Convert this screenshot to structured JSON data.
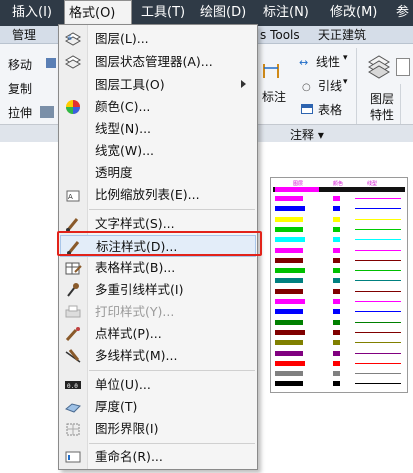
{
  "menubar": {
    "items": [
      "插入(I)",
      "格式(O)",
      "工具(T)",
      "绘图(D)",
      "标注(N)",
      "修改(M)",
      "参"
    ]
  },
  "tabs": [
    "管理",
    "s Tools",
    "天正建筑"
  ],
  "ribbon": {
    "left_tools": [
      "移动",
      "复制",
      "拉伸"
    ],
    "annotation_tools": [
      "标注",
      "线性",
      "引线",
      "表格"
    ],
    "layer_label": "图层",
    "layer_label2": "特性",
    "panel_title": "注释 ▾"
  },
  "format_menu": {
    "items": [
      {
        "label": "图层(L)...",
        "icon": "layer-icon"
      },
      {
        "label": "图层状态管理器(A)...",
        "icon": "layer-state-icon"
      },
      {
        "label": "图层工具(O)",
        "icon": "",
        "submenu": true
      },
      {
        "label": "颜色(C)...",
        "icon": "color-wheel-icon"
      },
      {
        "label": "线型(N)...",
        "icon": ""
      },
      {
        "label": "线宽(W)...",
        "icon": ""
      },
      {
        "label": "透明度",
        "icon": ""
      },
      {
        "label": "比例缩放列表(E)...",
        "icon": "scale-list-icon"
      },
      {
        "label": "文字样式(S)...",
        "icon": "text-style-icon"
      },
      {
        "label": "标注样式(D)...",
        "icon": "dim-style-icon"
      },
      {
        "label": "表格样式(B)...",
        "icon": "table-style-icon"
      },
      {
        "label": "多重引线样式(I)",
        "icon": "mleader-style-icon"
      },
      {
        "label": "打印样式(Y)...",
        "icon": "plot-style-icon",
        "disabled": true
      },
      {
        "label": "点样式(P)...",
        "icon": "point-style-icon"
      },
      {
        "label": "多线样式(M)...",
        "icon": "mline-style-icon"
      },
      {
        "label": "单位(U)...",
        "icon": "units-icon"
      },
      {
        "label": "厚度(T)",
        "icon": "thickness-icon"
      },
      {
        "label": "图形界限(I)",
        "icon": "limits-icon"
      },
      {
        "label": "重命名(R)...",
        "icon": "rename-icon"
      }
    ],
    "highlighted": "标注样式(D)..."
  },
  "sheet": {
    "headers": [
      "图层",
      "颜色",
      "线型"
    ],
    "colors": [
      "#ff00ff",
      "#0000ff",
      "#ffff00",
      "#00cc00",
      "#00ffff",
      "#ff00ff",
      "#800000",
      "#00c000",
      "#008080",
      "#800000",
      "#ff00ff",
      "#0000ff",
      "#008000",
      "#800000",
      "#808000",
      "#800080",
      "#ff0000",
      "#808080",
      "#000000"
    ]
  }
}
